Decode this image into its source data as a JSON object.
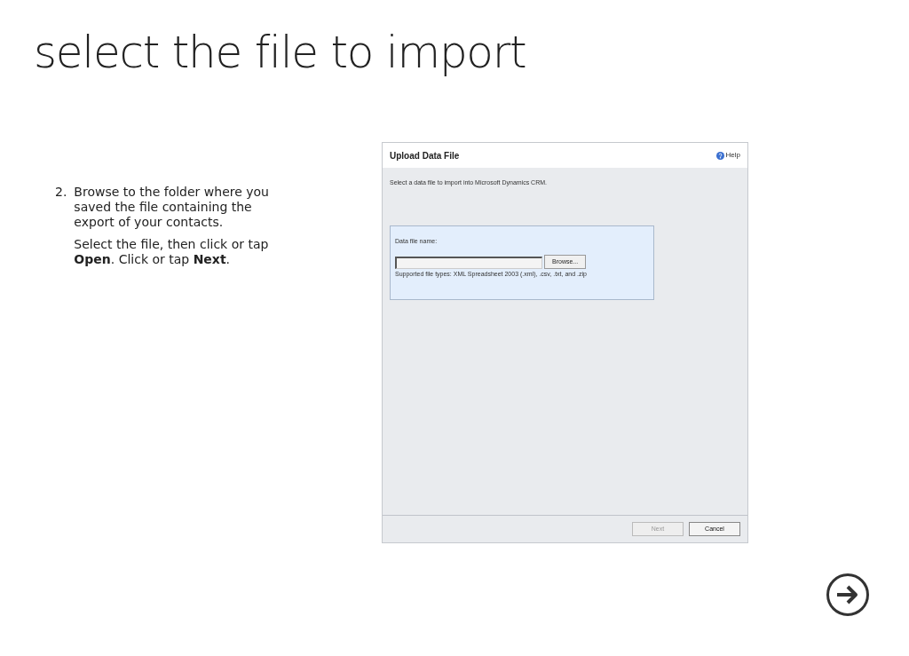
{
  "slide_title": "select the file to import",
  "steps": [
    {
      "number": "2.",
      "paragraphs": [
        "Browse to the folder where you saved the file containing the export of your contacts.",
        "Select the file, then click or tap **Open**. Click or tap **Next**."
      ]
    }
  ],
  "dialog": {
    "title": "Upload Data File",
    "help": "Help",
    "instruction": "Select a data file to import into Microsoft Dynamics CRM.",
    "field_label": "Data file name:",
    "browse": "Browse...",
    "supported": "Supported file types: XML Spreadsheet 2003 (.xml), .csv, .txt, and .zip",
    "buttons": [
      {
        "label": "Next",
        "disabled": true
      },
      {
        "label": "Cancel",
        "disabled": false
      }
    ]
  }
}
